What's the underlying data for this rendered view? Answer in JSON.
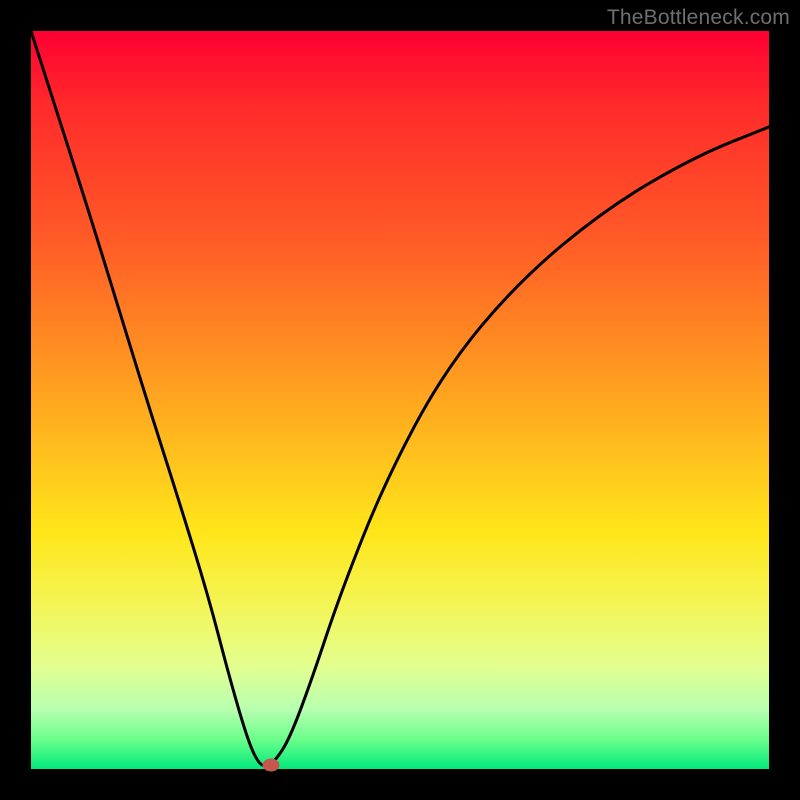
{
  "watermark": "TheBottleneck.com",
  "colors": {
    "curve_stroke": "#000000",
    "marker_fill": "#c7564e",
    "frame_bg": "#000000"
  },
  "chart_data": {
    "type": "line",
    "title": "",
    "xlabel": "",
    "ylabel": "",
    "xlim": [
      0,
      100
    ],
    "ylim": [
      0,
      100
    ],
    "grid": false,
    "series": [
      {
        "name": "bottleneck-curve",
        "x": [
          0,
          4,
          8,
          12,
          16,
          20,
          24,
          27,
          29.5,
          31,
          32,
          33,
          35,
          38,
          42,
          48,
          56,
          66,
          78,
          90,
          100
        ],
        "y": [
          100,
          87.5,
          75,
          62,
          49,
          36.5,
          23.5,
          12,
          3.5,
          0.5,
          0.5,
          1,
          4,
          12,
          24,
          39,
          54,
          66,
          76,
          83,
          87
        ]
      }
    ],
    "annotations": [
      {
        "name": "min-marker",
        "x": 32.5,
        "y": 0.5
      }
    ],
    "note": "Values are estimated from pixel positions relative to a 0–100 × 0–100 plot domain; no axis ticks or numeric labels are visible in the image."
  }
}
